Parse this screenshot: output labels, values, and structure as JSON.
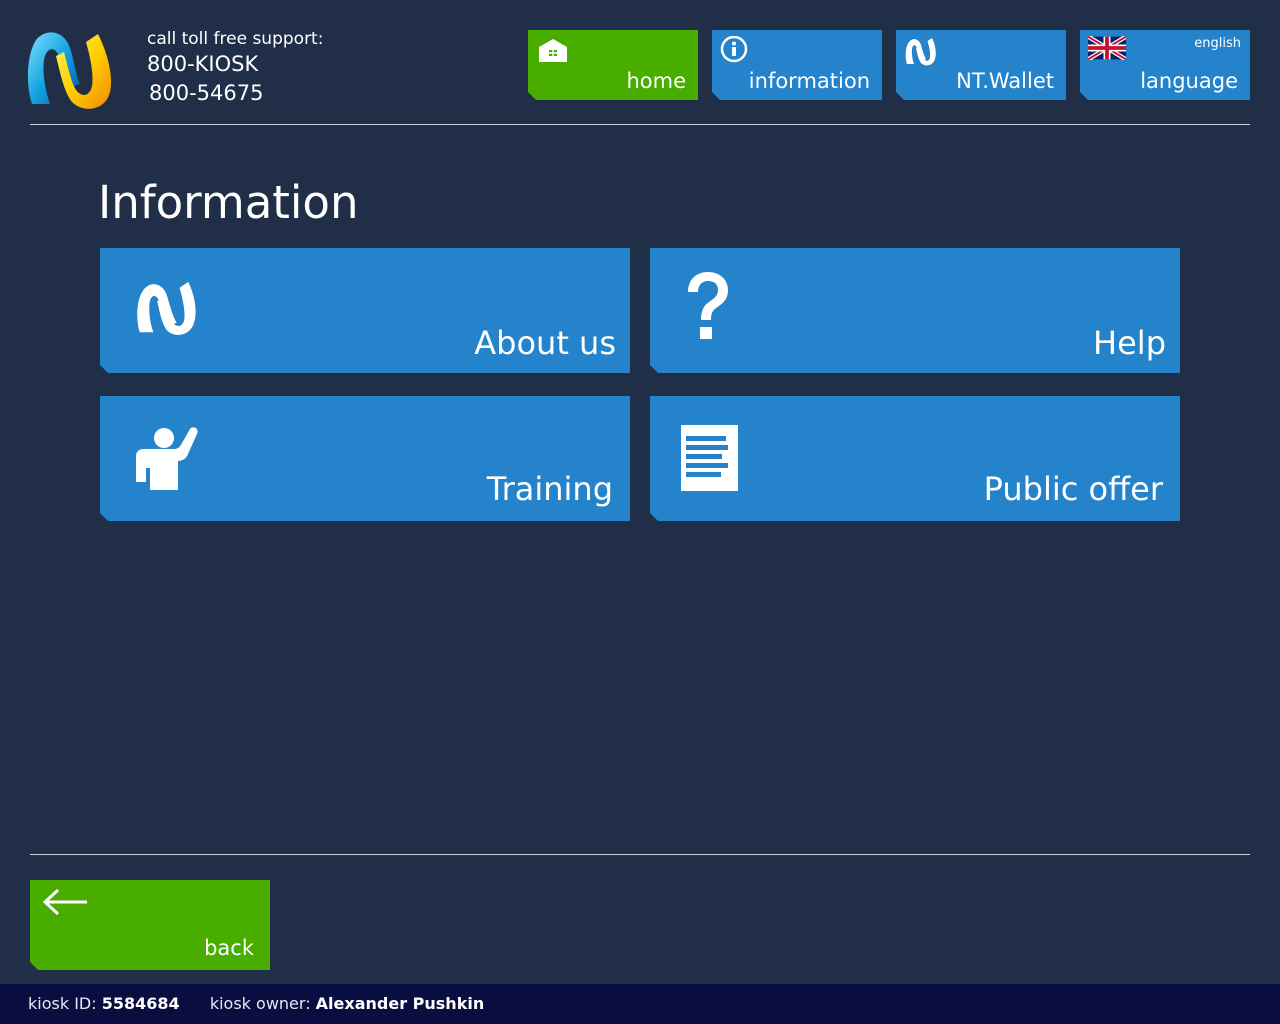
{
  "header": {
    "support_label": "call toll free support:",
    "phone_primary": "800-KIOSK",
    "phone_secondary": "800-54675"
  },
  "nav": {
    "home": {
      "label": "home",
      "icon": "home-icon",
      "color": "#49ad00"
    },
    "information": {
      "label": "information",
      "icon": "info-icon",
      "color": "#2583cb"
    },
    "wallet": {
      "label": "NT.Wallet",
      "icon": "wallet-logo-icon",
      "color": "#2583cb"
    },
    "language": {
      "label": "language",
      "current": "english",
      "icon": "uk-flag-icon",
      "color": "#2583cb"
    }
  },
  "main": {
    "title": "Information",
    "tiles": [
      {
        "label": "About us",
        "icon": "brand-logo-icon"
      },
      {
        "label": "Help",
        "icon": "question-mark-icon"
      },
      {
        "label": "Training",
        "icon": "person-raising-hand-icon"
      },
      {
        "label": "Public offer",
        "icon": "document-icon"
      }
    ]
  },
  "back": {
    "label": "back",
    "icon": "arrow-left-icon",
    "color": "#49ad00"
  },
  "footer": {
    "kiosk_id_label": "kiosk ID:",
    "kiosk_id": "5584684",
    "owner_label": "kiosk owner:",
    "owner": "Alexander Pushkin"
  },
  "colors": {
    "background": "#212e48",
    "tile_blue": "#2583cb",
    "accent_green": "#49ad00",
    "footer_bg": "#0a0d3f"
  }
}
